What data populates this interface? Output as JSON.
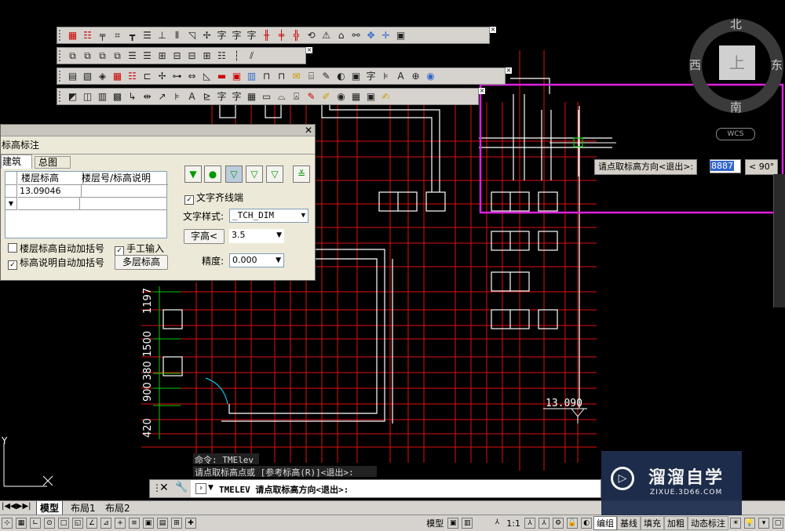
{
  "toolbars": [
    {
      "icons": [
        "grid-icon",
        "columns-icon",
        "beam-icon",
        "wall-icon",
        "dim-icon",
        "align-icon",
        "axis-icon",
        "axis2-icon",
        "arc-icon",
        "point-icon",
        "text-icon",
        "word-icon",
        "word2-icon",
        "stairs-icon",
        "stairs2-icon",
        "stairs3-icon",
        "rotate-icon",
        "elev-icon",
        "north-icon",
        "link-icon",
        "move-icon",
        "cross-icon",
        "paste-icon"
      ]
    },
    {
      "icons": [
        "b1-icon",
        "b2-icon",
        "b3-icon",
        "b4-icon",
        "b5-icon",
        "b6-icon",
        "b7-icon",
        "b8-icon",
        "b9-icon",
        "b10-icon",
        "b11-icon",
        "b12-icon",
        "b13-icon"
      ]
    },
    {
      "icons": [
        "c1-icon",
        "c2-icon",
        "c3-icon",
        "c4-icon",
        "c5-icon",
        "c6-icon",
        "c7-icon",
        "c8-icon",
        "c9-icon",
        "c10-icon",
        "c11-icon",
        "c12-icon",
        "c13-icon",
        "c14-icon",
        "c15-icon",
        "c16-icon",
        "c17-icon",
        "c18-icon",
        "c19-icon",
        "c20-icon",
        "c21-icon",
        "c22-icon",
        "c23-icon",
        "c24-icon",
        "c25-icon",
        "c26-icon",
        "c27-icon",
        "c28-icon"
      ]
    },
    {
      "icons": [
        "d1-icon",
        "d2-icon",
        "d3-icon",
        "d4-icon",
        "d5-icon",
        "d6-icon",
        "d7-icon",
        "d8-icon",
        "d9-icon",
        "d10-icon",
        "d11-icon",
        "d12-icon",
        "d13-icon",
        "d14-icon",
        "d15-icon",
        "d16-icon",
        "d17-icon",
        "d18-icon",
        "d19-icon",
        "d20-icon",
        "d21-icon",
        "d22-icon",
        "d23-icon"
      ]
    }
  ],
  "compass": {
    "north": "北",
    "south": "南",
    "west": "西",
    "east": "东",
    "top": "上",
    "wcs": "WCS"
  },
  "dialog": {
    "title": "标高标注",
    "tabs": [
      "建筑",
      "总图"
    ],
    "table": {
      "headers": [
        "楼层标高",
        "楼层号/标高说明"
      ],
      "rows": [
        [
          "13.09046",
          ""
        ],
        [
          "",
          ""
        ]
      ]
    },
    "chk_floor_bracket": "楼层标高自动加括号",
    "chk_manual_input": "手工输入",
    "chk_desc_bracket": "标高说明自动加括号",
    "multi_level_button": "多层标高",
    "chk_text_align": "文字齐线端",
    "text_style_label": "文字样式:",
    "text_style_value": "_TCH_DIM",
    "text_height_button": "字高<",
    "text_height_value": "3.5",
    "precision_label": "精度:",
    "precision_value": "0.000"
  },
  "prompt": {
    "label": "请点取标高方向<退出>:",
    "value": "8887",
    "angle": "< 90°"
  },
  "drawing": {
    "dims": [
      "1197",
      "1500",
      "380",
      "900",
      "420"
    ],
    "elevation": "13.090",
    "ucs_y": "Y"
  },
  "command": {
    "history_line1": "命令: TMElev",
    "history_line2": "请点取标高点或 [参考标高(R)]<退出>:",
    "current": "TMELEV 请点取标高方向<退出>:"
  },
  "tabs": {
    "model": "模型",
    "layout1": "布局1",
    "layout2": "布局2"
  },
  "status": {
    "model": "模型",
    "scale": "1:1",
    "buttons": [
      "编组",
      "基线",
      "填充",
      "加粗",
      "动态标注"
    ]
  },
  "watermark": {
    "name": "溜溜自学",
    "url": "ZIXUE.3D66.COM"
  },
  "colors": {
    "highlight": "#e020e0",
    "grid": "#e01010",
    "wall": "#ffffff",
    "dim": "#00cc00"
  }
}
